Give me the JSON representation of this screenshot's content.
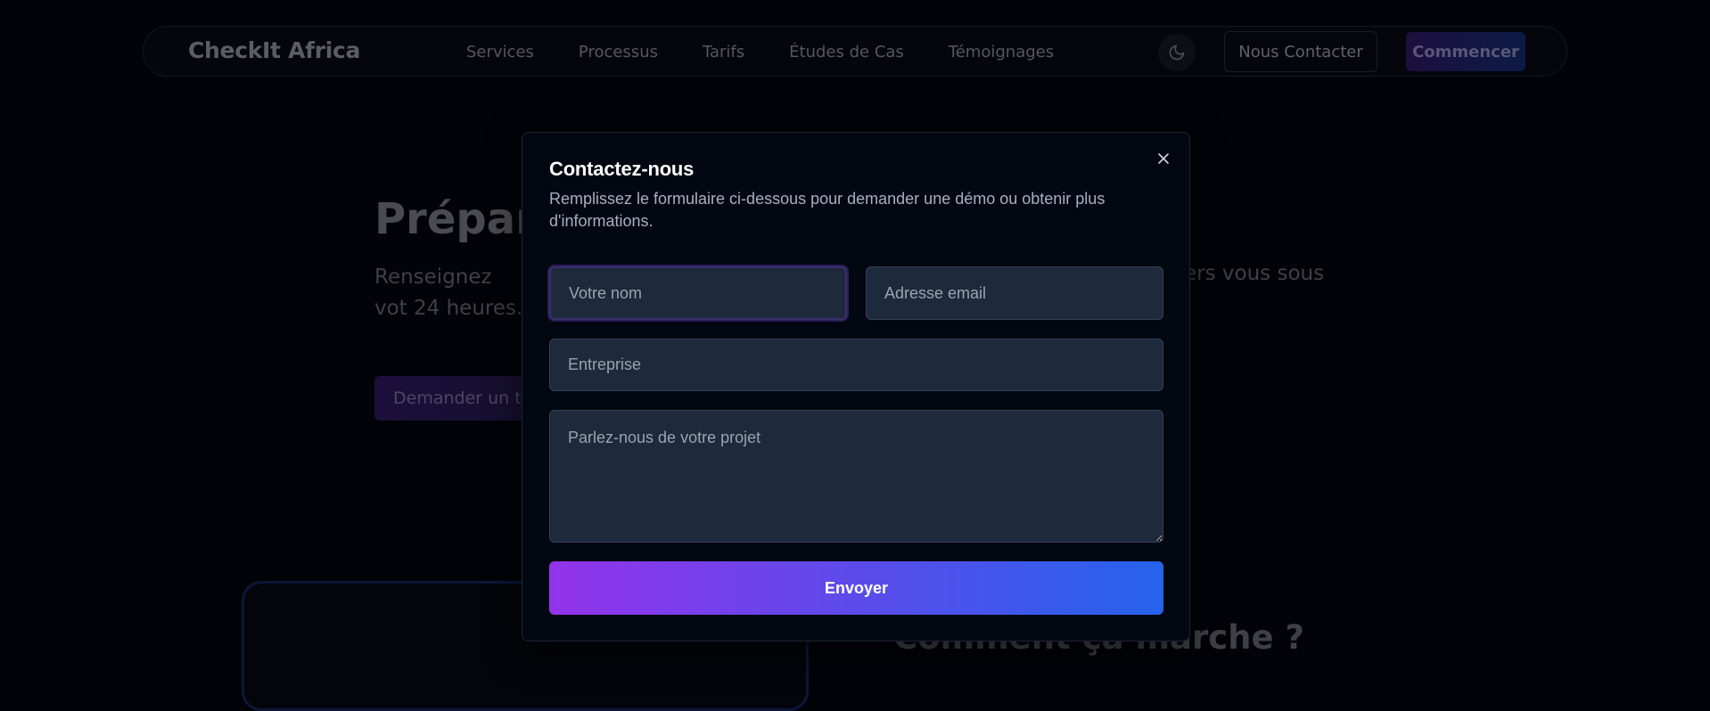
{
  "navbar": {
    "logo": "CheckIt Africa",
    "links": [
      "Services",
      "Processus",
      "Tarifs",
      "Études de Cas",
      "Témoignages"
    ],
    "contact_label": "Nous Contacter",
    "start_label": "Commencer"
  },
  "hero": {
    "title_visible": "Prépare",
    "subtitle_left": "Renseignez vot 24 heures.",
    "subtitle_right": "ers vous sous",
    "cta_label": "Demander un tes"
  },
  "section": {
    "title": "Comment ça marche ?"
  },
  "modal": {
    "title": "Contactez-nous",
    "description": "Remplissez le formulaire ci-dessous pour demander une démo ou obtenir plus d'informations.",
    "name_placeholder": "Votre nom",
    "email_placeholder": "Adresse email",
    "company_placeholder": "Entreprise",
    "message_placeholder": "Parlez-nous de votre projet",
    "submit_label": "Envoyer"
  },
  "colors": {
    "modal_bg": "#030712",
    "input_bg": "#1e293b",
    "gradient_start": "#9333ea",
    "gradient_end": "#2563eb"
  }
}
